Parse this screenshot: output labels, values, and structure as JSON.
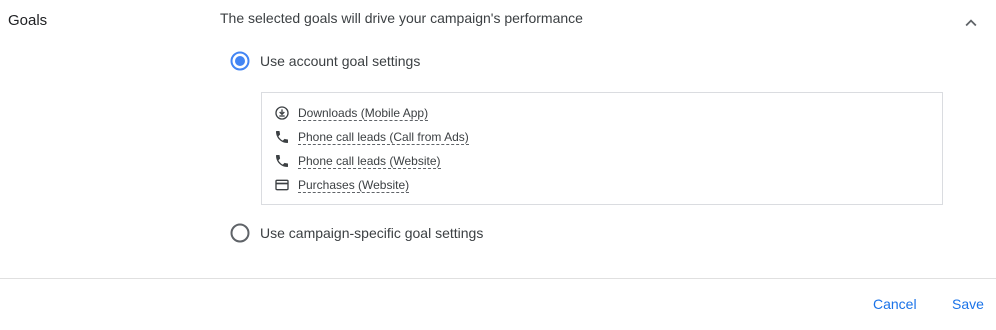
{
  "section": {
    "title": "Goals",
    "subtitle": "The selected goals will drive your campaign's performance"
  },
  "options": {
    "account": {
      "label": "Use account goal settings",
      "selected": true
    },
    "campaign": {
      "label": "Use campaign-specific goal settings",
      "selected": false
    }
  },
  "goals": [
    {
      "label": "Downloads (Mobile App)",
      "icon": "download-icon"
    },
    {
      "label": "Phone call leads (Call from Ads)",
      "icon": "phone-icon"
    },
    {
      "label": "Phone call leads (Website)",
      "icon": "phone-icon"
    },
    {
      "label": "Purchases (Website)",
      "icon": "credit-card-icon"
    }
  ],
  "actions": {
    "cancel_label": "Cancel",
    "save_label": "Save"
  },
  "colors": {
    "accent": "#1a73e8",
    "radio_selected": "#4285f4",
    "radio_unselected": "#5f6368",
    "border": "#dadce0"
  }
}
